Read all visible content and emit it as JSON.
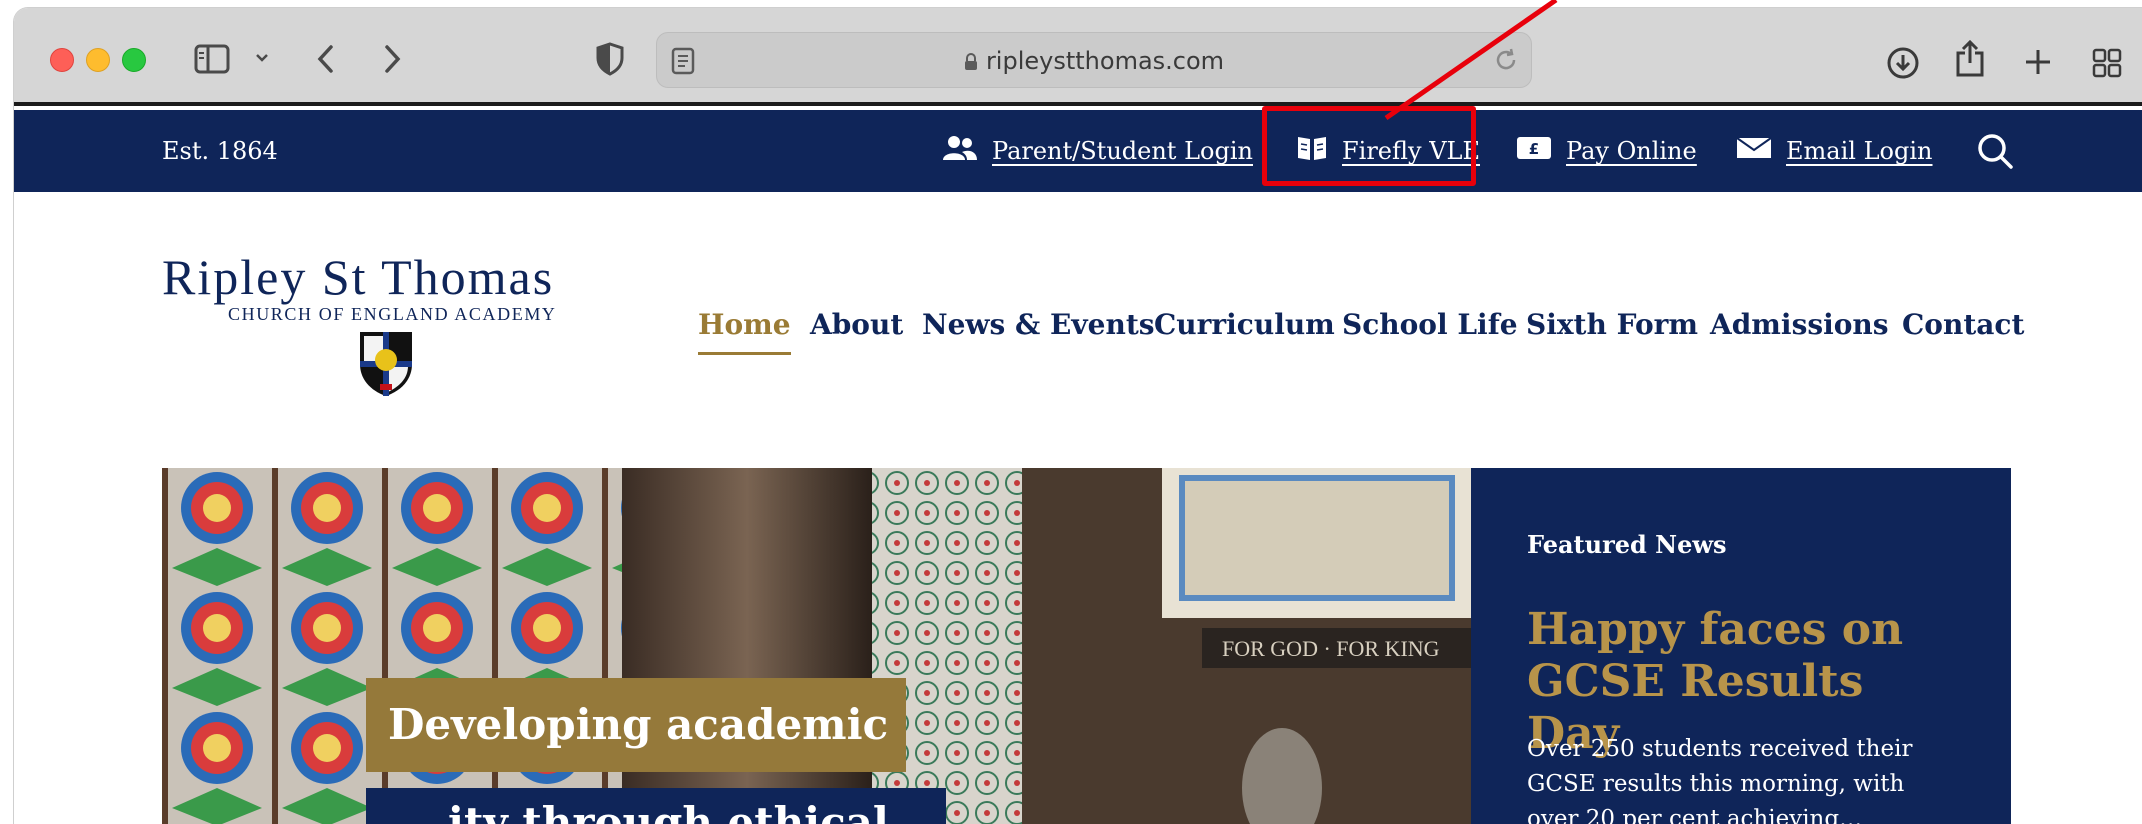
{
  "browser": {
    "url": "ripleystthomas.com"
  },
  "topbar": {
    "established": "Est. 1864",
    "links": [
      {
        "label": "Parent/Student Login",
        "icon": "users-icon"
      },
      {
        "label": "Firefly VLE",
        "icon": "book-icon"
      },
      {
        "label": "Pay Online",
        "icon": "pound-note-icon"
      },
      {
        "label": "Email Login",
        "icon": "envelope-icon"
      }
    ],
    "search_icon": "search-icon"
  },
  "logo": {
    "title": "Ripley St Thomas",
    "subtitle": "CHURCH OF ENGLAND ACADEMY"
  },
  "nav": {
    "items": [
      "Home",
      "About",
      "News & Events",
      "Curriculum",
      "School Life",
      "Sixth Form",
      "Admissions",
      "Contact"
    ],
    "active": "Home"
  },
  "hero": {
    "caption_line1": "Developing academic",
    "caption_line2": "…ity through ethical",
    "featured": {
      "label": "Featured News",
      "title": "Happy faces on GCSE Results Day",
      "text": "Over 250 students received their GCSE results this morning, with over 20 per cent achieving…"
    }
  },
  "colors": {
    "navy": "#0f2559",
    "gold": "#9a7b35",
    "highlight_red": "#e8000b"
  }
}
